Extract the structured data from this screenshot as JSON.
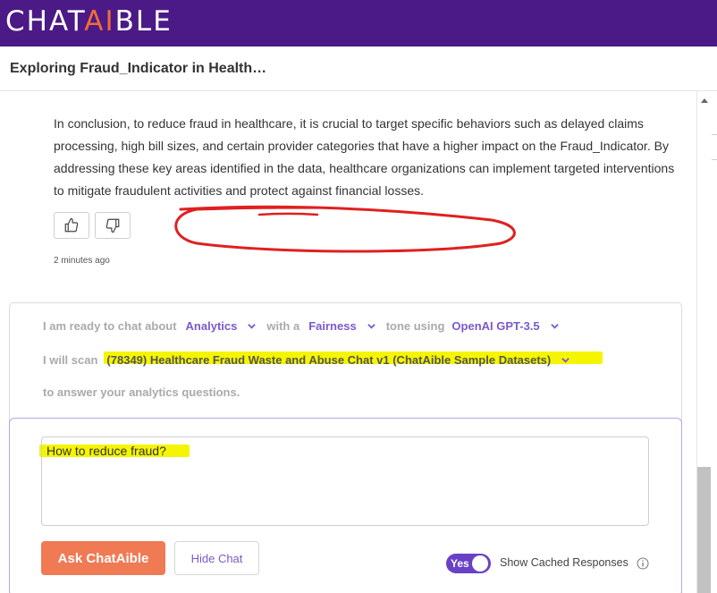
{
  "header": {
    "logo_text_left": "CHAT",
    "logo_text_accent": "AI",
    "logo_text_right": "BLE",
    "brand_color": "#4b1a86",
    "accent_color": "#f26b3a"
  },
  "conversation": {
    "title": "Exploring Fraud_Indicator in Health…",
    "message": "In conclusion, to reduce fraud in healthcare, it is crucial to target specific behaviors such as delayed claims processing, high bill sizes, and certain provider categories that have a higher impact on the Fraud_Indicator. By addressing these key areas identified in the data, healthcare organizations can implement targeted interventions to mitigate fraudulent activities and protect against financial losses.",
    "timestamp": "2 minutes ago",
    "icons": {
      "like": "thumbs-up-icon",
      "dislike": "thumbs-down-icon"
    }
  },
  "config": {
    "prefix": "I am ready to chat about",
    "topic": "Analytics",
    "mid": "with a",
    "tone": "Fairness",
    "tone_suffix": "tone using",
    "model": "OpenAI GPT-3.5",
    "scan_prefix": "I will scan",
    "dataset": "(78349) Healthcare Fraud Waste and Abuse Chat v1 (ChatAible Sample Datasets)",
    "suffix": "to answer your analytics questions."
  },
  "input": {
    "value": "How to reduce fraud?"
  },
  "actions": {
    "ask_label": "Ask ChatAible",
    "hide_label": "Hide Chat",
    "toggle_label": "Yes",
    "toggle_on": true,
    "cached_label": "Show Cached Responses"
  }
}
